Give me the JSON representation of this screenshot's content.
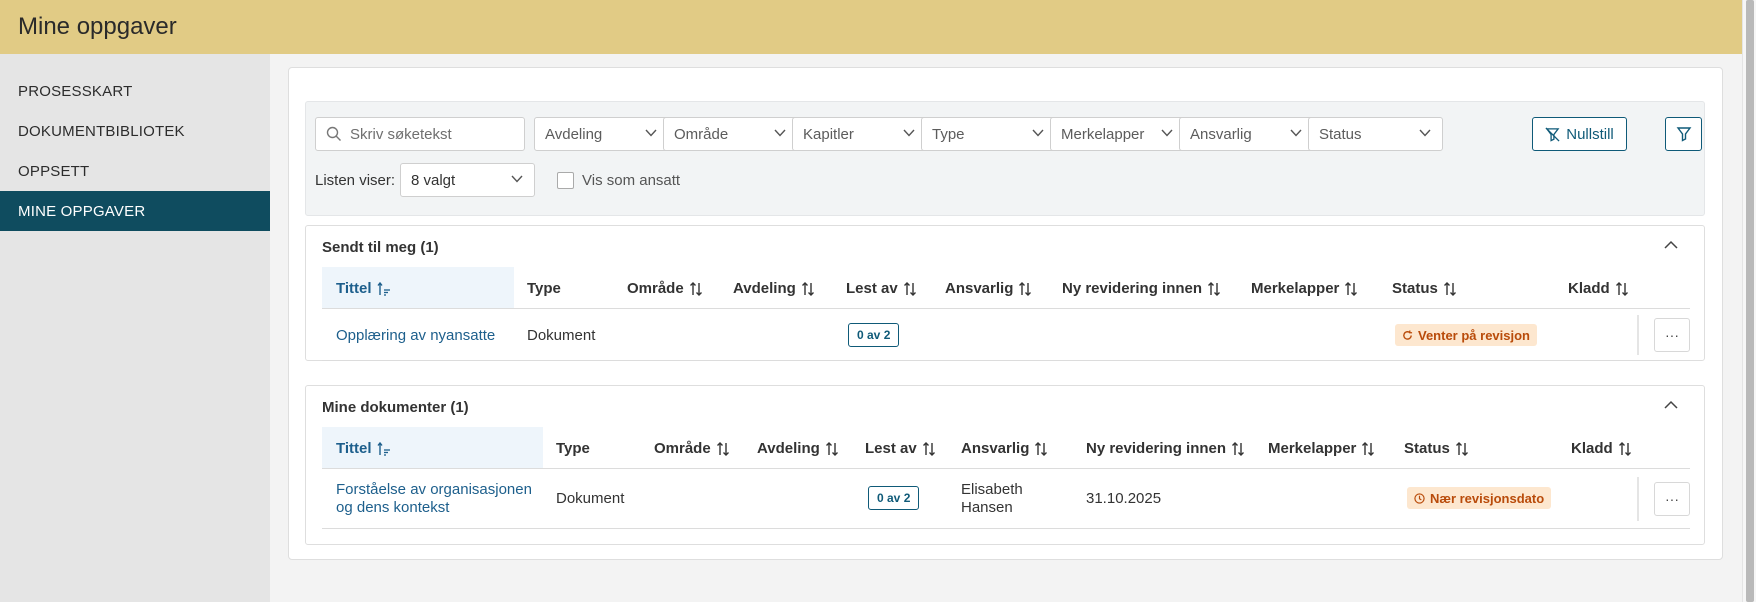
{
  "app": {
    "title": "Mine oppgaver"
  },
  "sidebar": {
    "items": [
      {
        "label": "PROSESSKART"
      },
      {
        "label": "DOKUMENTBIBLIOTEK"
      },
      {
        "label": "OPPSETT"
      },
      {
        "label": "MINE OPPGAVER",
        "active": true
      }
    ]
  },
  "filters": {
    "search_placeholder": "Skriv søketekst",
    "dropdowns": [
      {
        "label": "Avdeling"
      },
      {
        "label": "Område"
      },
      {
        "label": "Kapitler"
      },
      {
        "label": "Type"
      },
      {
        "label": "Merkelapper"
      },
      {
        "label": "Ansvarlig"
      },
      {
        "label": "Status"
      }
    ],
    "reset_label": "Nullstill",
    "list_shows_label": "Listen viser:",
    "list_shows_value": "8 valgt",
    "show_as_employee_label": "Vis som ansatt"
  },
  "sections": [
    {
      "title": "Sendt til meg (1)",
      "columns": [
        "Tittel",
        "Type",
        "Område",
        "Avdeling",
        "Lest av",
        "Ansvarlig",
        "Ny revidering innen",
        "Merkelapper",
        "Status",
        "Kladd"
      ],
      "rows": [
        {
          "title": "Opplæring av nyansatte",
          "type": "Dokument",
          "read_by": "0 av 2",
          "responsible": "",
          "revision": "",
          "status": "Venter på revisjon",
          "more": "···"
        }
      ]
    },
    {
      "title": "Mine dokumenter (1)",
      "columns": [
        "Tittel",
        "Type",
        "Område",
        "Avdeling",
        "Lest av",
        "Ansvarlig",
        "Ny revidering innen",
        "Merkelapper",
        "Status",
        "Kladd"
      ],
      "rows": [
        {
          "title": "Forståelse av organisasjonen og dens kontekst",
          "type": "Dokument",
          "read_by": "0 av 2",
          "responsible": "Elisabeth Hansen",
          "revision": "31.10.2025",
          "status": "Nær revisjonsdato",
          "more": "···"
        }
      ]
    }
  ],
  "colors": {
    "accent": "#0f5a78",
    "topbar": "#e1cb85",
    "sidebar_active": "#0f4c5f",
    "status_bg": "#fde7cf",
    "status_text": "#b94b0a"
  }
}
